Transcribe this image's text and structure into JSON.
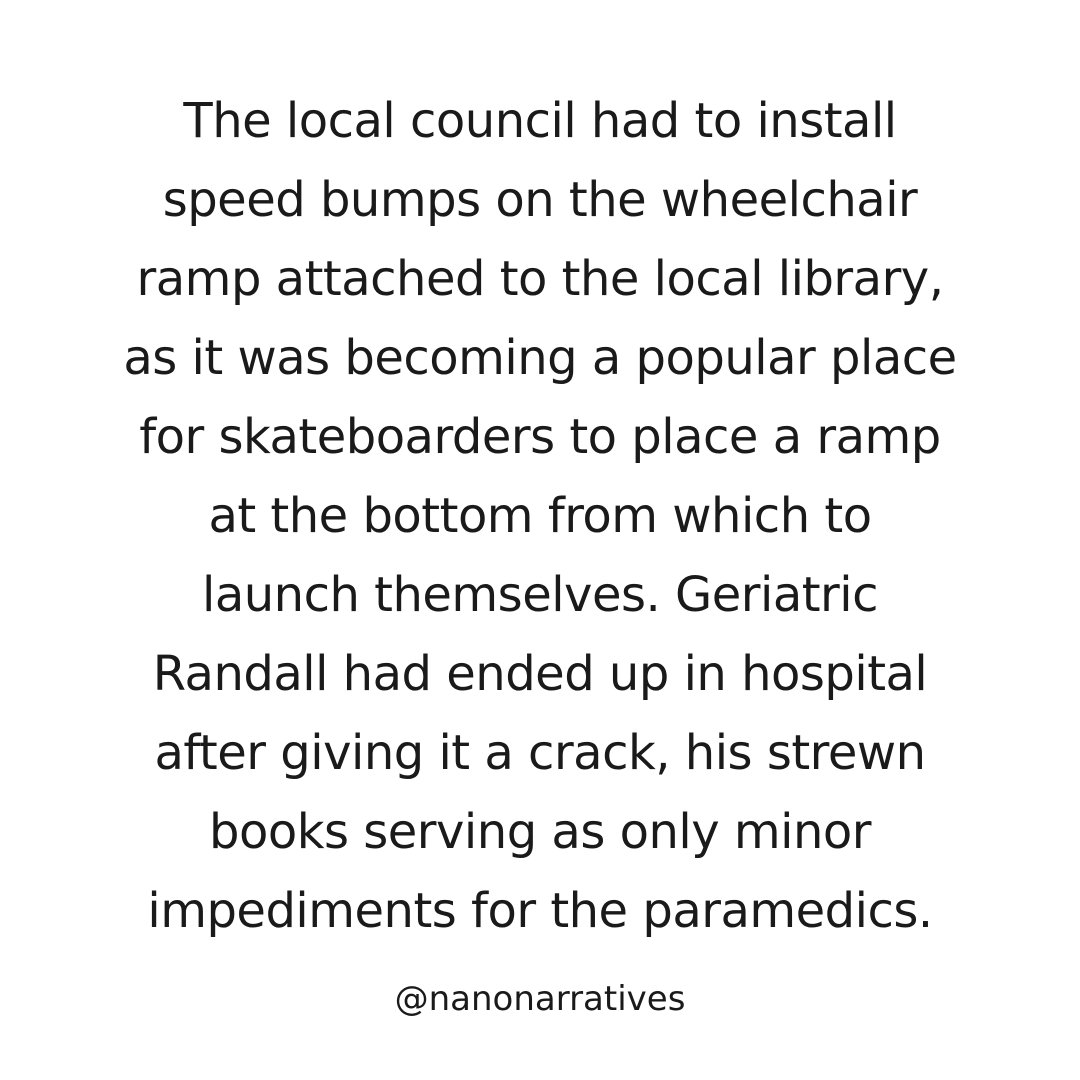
{
  "story": {
    "lines": [
      "The local council had to install",
      "speed bumps on the wheelchair",
      "ramp attached to the local library,",
      "as it was becoming a popular place",
      "for skateboarders to place a ramp",
      "at the bottom from which to",
      "launch themselves. Geriatric",
      "Randall had ended up in hospital",
      "after giving it a crack, his strewn",
      "books serving as only minor",
      "impediments for the paramedics."
    ]
  },
  "footer": {
    "handle": "@nanonarratives"
  },
  "colors": {
    "background": "#ffffff",
    "text": "#1a1a1a"
  }
}
